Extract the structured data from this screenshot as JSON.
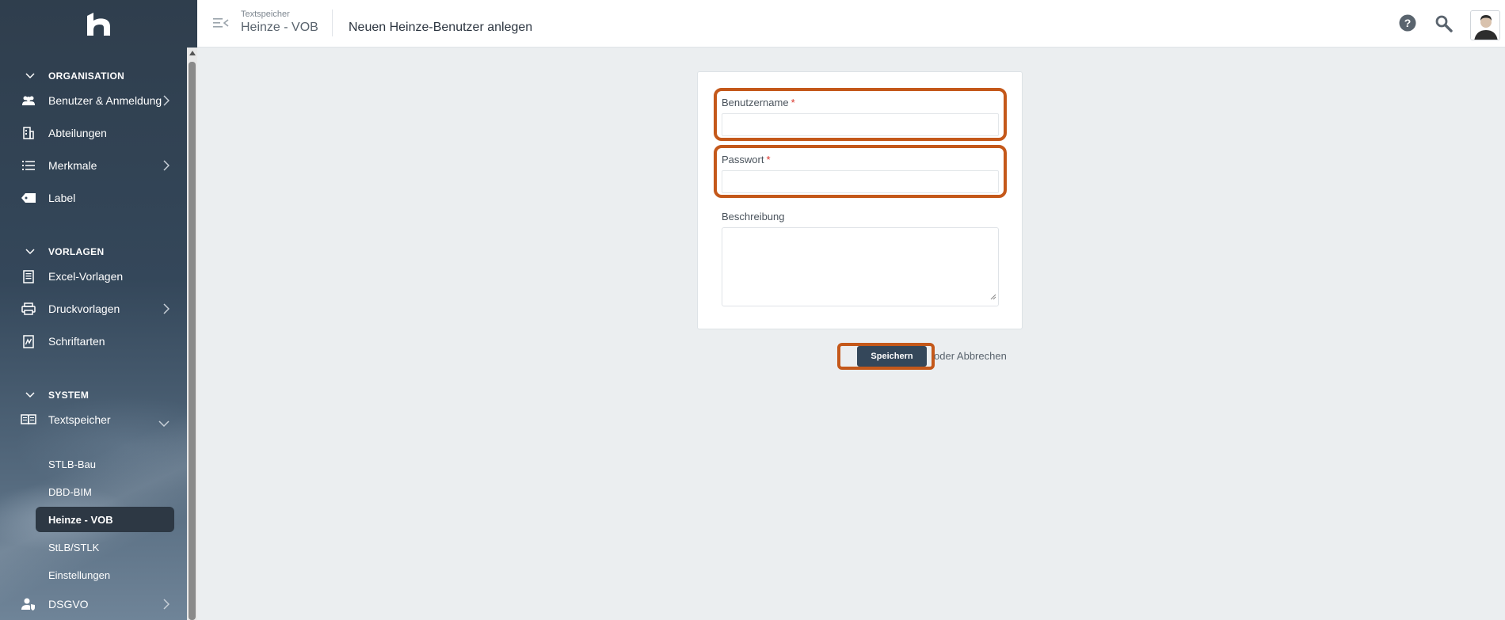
{
  "header": {
    "breadcrumb_parent": "Textspeicher",
    "breadcrumb_current": "Heinze - VOB",
    "page_title": "Neuen Heinze-Benutzer anlegen"
  },
  "sidebar": {
    "sections": [
      {
        "title": "ORGANISATION"
      },
      {
        "title": "VORLAGEN"
      },
      {
        "title": "SYSTEM"
      }
    ],
    "items": [
      {
        "label": "Benutzer & Anmeldung",
        "icon": "users-icon",
        "has_submenu": true
      },
      {
        "label": "Abteilungen",
        "icon": "building-icon",
        "has_submenu": false
      },
      {
        "label": "Merkmale",
        "icon": "list-icon",
        "has_submenu": true
      },
      {
        "label": "Label",
        "icon": "tag-icon",
        "has_submenu": false
      },
      {
        "label": "Excel-Vorlagen",
        "icon": "document-icon",
        "has_submenu": false
      },
      {
        "label": "Druckvorlagen",
        "icon": "printer-icon",
        "has_submenu": true
      },
      {
        "label": "Schriftarten",
        "icon": "font-file-icon",
        "has_submenu": false
      },
      {
        "label": "Textspeicher",
        "icon": "book-icon",
        "has_submenu": true,
        "expanded": true
      },
      {
        "label": "DSGVO",
        "icon": "user-shield-icon",
        "has_submenu": true
      }
    ],
    "subitems": [
      {
        "label": "STLB-Bau"
      },
      {
        "label": "DBD-BIM"
      },
      {
        "label": "Heinze - VOB",
        "active": true
      },
      {
        "label": "StLB/STLK"
      },
      {
        "label": "Einstellungen"
      }
    ]
  },
  "form": {
    "username": {
      "label": "Benutzername",
      "required_mark": "*",
      "value": ""
    },
    "password": {
      "label": "Passwort",
      "required_mark": "*",
      "value": ""
    },
    "description": {
      "label": "Beschreibung",
      "value": ""
    }
  },
  "actions": {
    "save_label": "Speichern",
    "cancel_label": "oder Abbrechen"
  },
  "colors": {
    "sidebar_bg": "#34475a",
    "highlight": "#c4581a",
    "required": "#d9342b",
    "primary_button": "#34475a"
  }
}
